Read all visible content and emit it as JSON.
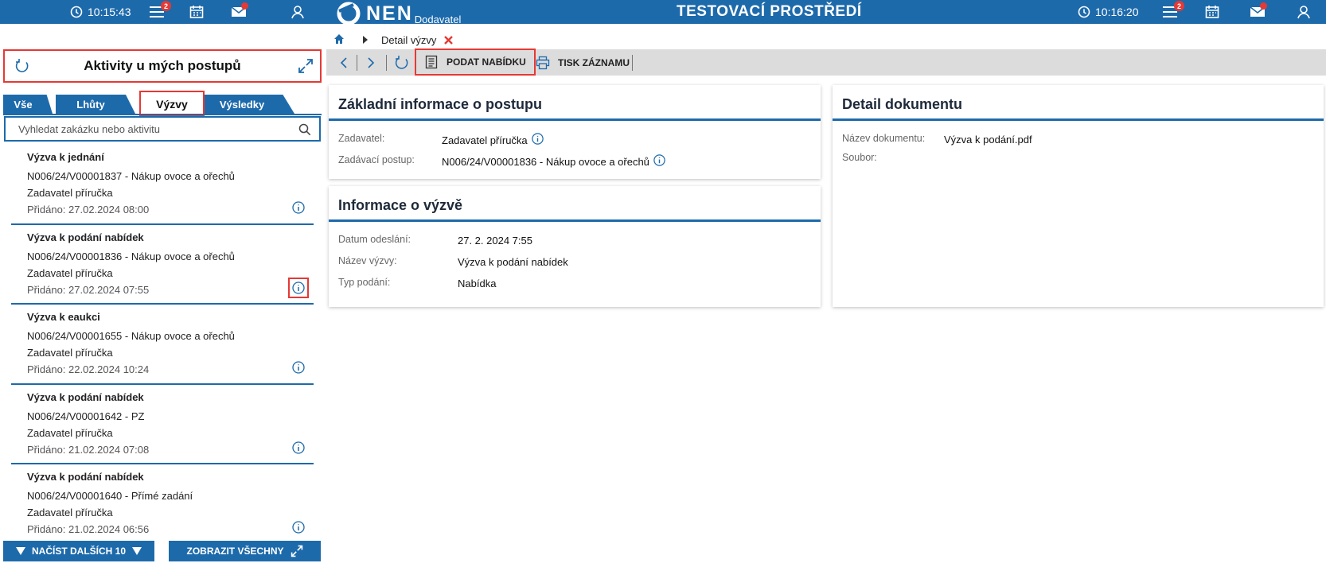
{
  "colors": {
    "brand": "#1d6aab",
    "highlight": "#e53935"
  },
  "topbar": {
    "clock_left": "10:15:43",
    "clock_right": "10:16:20",
    "menu_badge": "2",
    "logo_text": "NEN",
    "logo_sub": "Dodavatel",
    "environment_title": "TESTOVACÍ PROSTŘEDÍ"
  },
  "left_panel": {
    "title": "Aktivity u mých postupů",
    "tabs": [
      {
        "label": "Vše"
      },
      {
        "label": "Lhůty"
      },
      {
        "label": "Výzvy",
        "active": true
      },
      {
        "label": "Výsledky"
      }
    ],
    "search_placeholder": "Vyhledat zakázku nebo aktivitu",
    "items": [
      {
        "title": "Výzva k jednání",
        "procedure": "N006/24/V00001837 - Nákup ovoce a ořechů",
        "authority": "Zadavatel příručka",
        "added": "Přidáno: 27.02.2024 08:00"
      },
      {
        "title": "Výzva k podání nabídek",
        "procedure": "N006/24/V00001836 - Nákup ovoce a ořechů",
        "authority": "Zadavatel příručka",
        "added": "Přidáno: 27.02.2024 07:55"
      },
      {
        "title": "Výzva k eaukci",
        "procedure": "N006/24/V00001655 - Nákup ovoce a ořechů",
        "authority": "Zadavatel příručka",
        "added": "Přidáno: 22.02.2024 10:24"
      },
      {
        "title": "Výzva k podání nabídek",
        "procedure": "N006/24/V00001642 - PZ",
        "authority": "Zadavatel příručka",
        "added": "Přidáno: 21.02.2024 07:08"
      },
      {
        "title": "Výzva k podání nabídek",
        "procedure": "N006/24/V00001640 - Přímé zadání",
        "authority": "Zadavatel příručka",
        "added": "Přidáno: 21.02.2024 06:56"
      }
    ],
    "load_more_label": "NAČÍST DALŠÍCH 10",
    "show_all_label": "ZOBRAZIT VŠECHNY"
  },
  "breadcrumb": {
    "current": "Detail výzvy"
  },
  "toolbar": {
    "submit_offer": "PODAT NABÍDKU",
    "print_record": "TISK ZÁZNAMU"
  },
  "basic_info": {
    "title": "Základní informace o postupu",
    "contracting_authority_label": "Zadavatel:",
    "contracting_authority_value": "Zadavatel příručka",
    "procedure_label": "Zadávací postup:",
    "procedure_value": "N006/24/V00001836 - Nákup ovoce a ořechů"
  },
  "call_info": {
    "title": "Informace o výzvě",
    "sent_label": "Datum odeslání:",
    "sent_value": "27. 2. 2024 7:55",
    "name_label": "Název výzvy:",
    "name_value": "Výzva k podání nabídek",
    "type_label": "Typ podání:",
    "type_value": "Nabídka"
  },
  "document_detail": {
    "title": "Detail dokumentu",
    "doc_name_label": "Název dokumentu:",
    "doc_name_value": "Výzva k podání.pdf",
    "file_label": "Soubor:"
  }
}
